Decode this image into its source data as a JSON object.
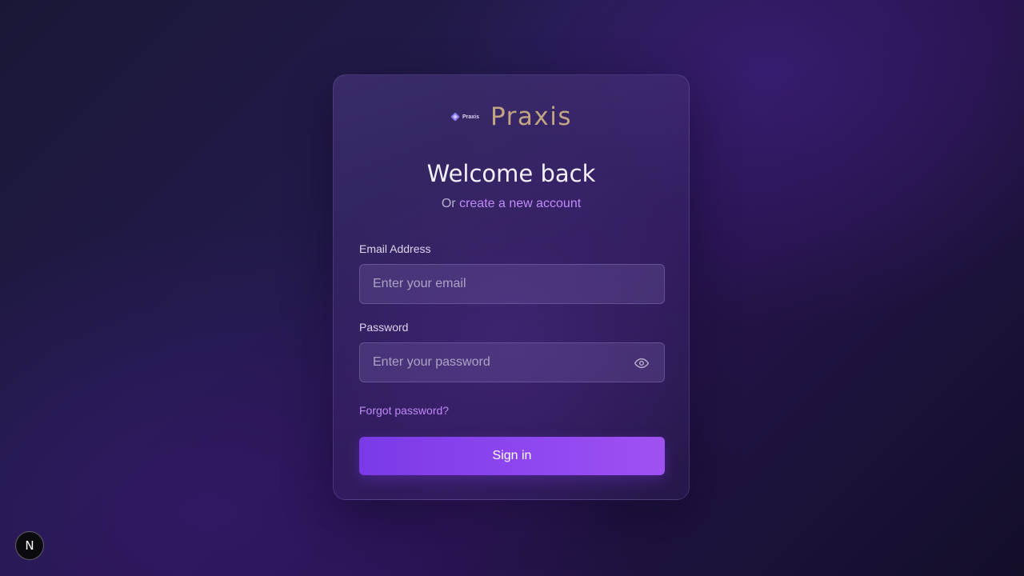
{
  "brand": {
    "logo_text": "Praxis",
    "name": "Praxis",
    "name_color": "#c2a583"
  },
  "heading": "Welcome back",
  "subheading": {
    "prefix": "Or",
    "link_label": "create a new account"
  },
  "form": {
    "email": {
      "label": "Email Address",
      "placeholder": "Enter your email",
      "value": ""
    },
    "password": {
      "label": "Password",
      "placeholder": "Enter your password",
      "value": "",
      "toggle_icon": "eye-icon"
    },
    "forgot_label": "Forgot password?",
    "submit_label": "Sign in"
  },
  "dev_badge": {
    "letter": "N"
  },
  "colors": {
    "accent": "#8b45ee",
    "link": "#c08af8",
    "background": "#221a4a"
  }
}
